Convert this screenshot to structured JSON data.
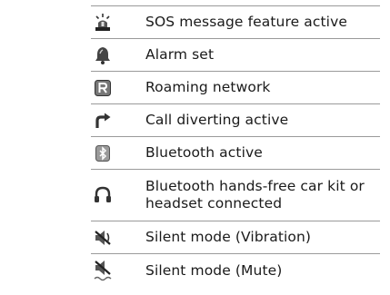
{
  "status_icons": [
    {
      "icon": "sos-beacon-icon",
      "label": "SOS message feature active"
    },
    {
      "icon": "alarm-bell-icon",
      "label": "Alarm set"
    },
    {
      "icon": "roaming-r-icon",
      "label": "Roaming network"
    },
    {
      "icon": "call-divert-arrow-icon",
      "label": "Call diverting active"
    },
    {
      "icon": "bluetooth-icon",
      "label": "Bluetooth active"
    },
    {
      "icon": "headset-icon",
      "label_line1": "Bluetooth hands-free car kit or",
      "label_line2": "headset connected"
    },
    {
      "icon": "silent-vibration-icon",
      "label": "Silent mode (Vibration)"
    },
    {
      "icon": "silent-mute-icon",
      "label": "Silent mode (Mute)"
    }
  ]
}
